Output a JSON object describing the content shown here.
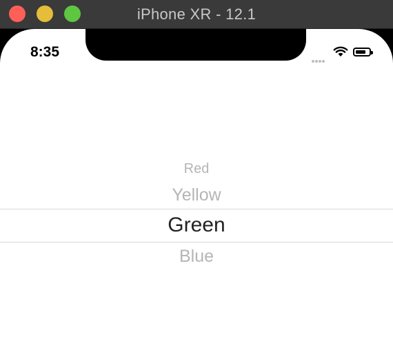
{
  "window": {
    "title": "iPhone XR - 12.1"
  },
  "status_bar": {
    "time": "8:35",
    "icons": [
      "cellular-signal-icon",
      "wifi-icon",
      "battery-icon"
    ]
  },
  "picker": {
    "items": [
      "Red",
      "Yellow",
      "Green",
      "Blue"
    ],
    "selected": "Green"
  }
}
